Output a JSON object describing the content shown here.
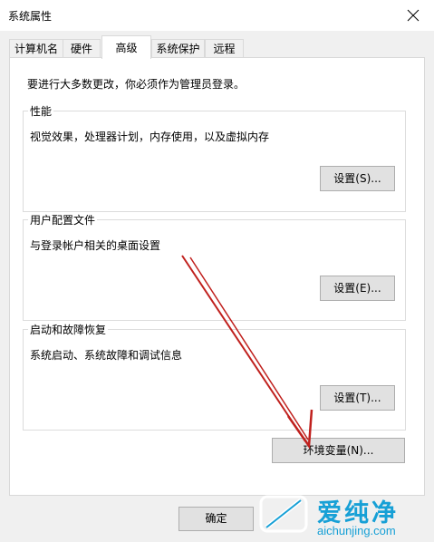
{
  "window": {
    "title": "系统属性"
  },
  "tabs": [
    {
      "label": "计算机名"
    },
    {
      "label": "硬件"
    },
    {
      "label": "高级"
    },
    {
      "label": "系统保护"
    },
    {
      "label": "远程"
    }
  ],
  "active_tab": "高级",
  "admin_note": "要进行大多数更改，你必须作为管理员登录。",
  "groups": {
    "performance": {
      "title": "性能",
      "description": "视觉效果，处理器计划，内存使用，以及虚拟内存",
      "button": "设置(S)..."
    },
    "user_profiles": {
      "title": "用户配置文件",
      "description": "与登录帐户相关的桌面设置",
      "button": "设置(E)..."
    },
    "startup_recovery": {
      "title": "启动和故障恢复",
      "description": "系统启动、系统故障和调试信息",
      "button": "设置(T)..."
    }
  },
  "env_button": "环境变量(N)...",
  "ok_button": "确定",
  "watermark": {
    "name": "爱纯净",
    "domain": "aichunjing.com"
  },
  "colors": {
    "arrow": "#c0201d",
    "watermark": "#17a0d6",
    "button_face": "#e1e1e1",
    "button_border": "#adadad"
  }
}
